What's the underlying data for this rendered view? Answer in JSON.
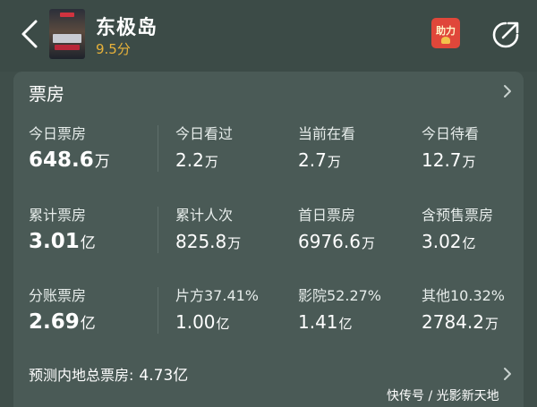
{
  "header": {
    "title": "东极岛",
    "score": "9.5分",
    "boost_label": "助力"
  },
  "box_office": {
    "section_title": "票房",
    "rows": [
      [
        {
          "label": "今日票房",
          "value": "648.6",
          "unit": "万"
        },
        {
          "label": "今日看过",
          "value": "2.2",
          "unit": "万"
        },
        {
          "label": "当前在看",
          "value": "2.7",
          "unit": "万"
        },
        {
          "label": "今日待看",
          "value": "12.7",
          "unit": "万"
        }
      ],
      [
        {
          "label": "累计票房",
          "value": "3.01",
          "unit": "亿"
        },
        {
          "label": "累计人次",
          "value": "825.8",
          "unit": "万"
        },
        {
          "label": "首日票房",
          "value": "6976.6",
          "unit": "万"
        },
        {
          "label": "含预售票房",
          "value": "3.02",
          "unit": "亿"
        }
      ],
      [
        {
          "label": "分账票房",
          "value": "2.69",
          "unit": "亿"
        },
        {
          "label": "片方37.41%",
          "value": "1.00",
          "unit": "亿"
        },
        {
          "label": "影院52.27%",
          "value": "1.41",
          "unit": "亿"
        },
        {
          "label": "其他10.32%",
          "value": "2784.2",
          "unit": "万"
        }
      ]
    ],
    "forecast_label": "预测内地总票房:",
    "forecast_value": "4.73亿"
  },
  "watermark": "快传号 / 光影新天地",
  "colors": {
    "background": "#3f4e4a",
    "card": "#4a5a56",
    "score": "#e8b23a",
    "boost_button": "#e0473a"
  },
  "icons": {
    "back": "chevron-left-icon",
    "share": "share-arrow-icon",
    "section_more": "chevron-right-icon",
    "forecast_more": "chevron-right-icon"
  }
}
